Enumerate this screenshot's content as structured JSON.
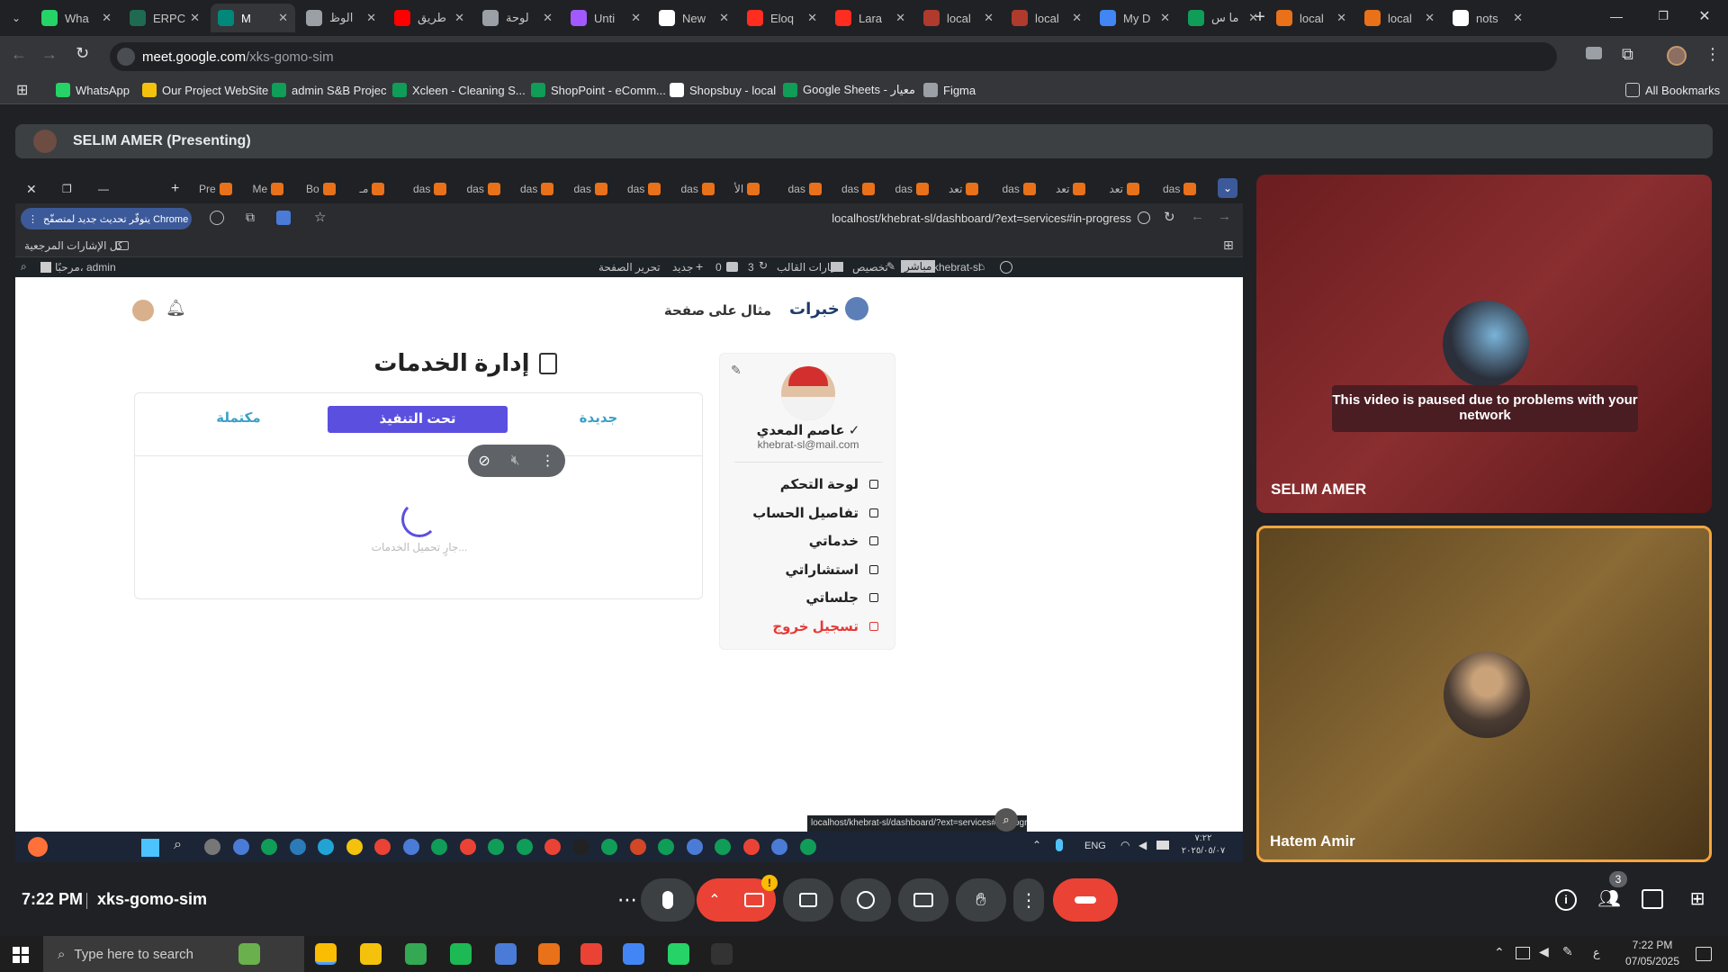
{
  "browser": {
    "tabs": [
      {
        "label": "Wha",
        "color": "#25d366"
      },
      {
        "label": "ERPC",
        "color": "#1e6b52"
      },
      {
        "label": "M",
        "color": "#00897b"
      },
      {
        "label": "الوظ",
        "color": "#9aa0a6"
      },
      {
        "label": "طريق",
        "color": "#ff0000"
      },
      {
        "label": "لوحة",
        "color": "#9aa0a6"
      },
      {
        "label": "Unti",
        "color": "#a259ff"
      },
      {
        "label": "New",
        "color": "#ffffff"
      },
      {
        "label": "Eloq",
        "color": "#ff2d20"
      },
      {
        "label": "Lara",
        "color": "#ff2d20"
      },
      {
        "label": "local",
        "color": "#b03a2e"
      },
      {
        "label": "local",
        "color": "#b03a2e"
      },
      {
        "label": "My D",
        "color": "#4285f4"
      },
      {
        "label": "ما س",
        "color": "#0f9d58"
      },
      {
        "label": "local",
        "color": "#e8711a"
      },
      {
        "label": "local",
        "color": "#e8711a"
      },
      {
        "label": "nots",
        "color": "#ffffff"
      }
    ],
    "url_host": "meet.google.com",
    "url_path": "/xks-gomo-sim",
    "bookmarks": [
      {
        "label": "WhatsApp",
        "color": "#25d366"
      },
      {
        "label": "Our Project WebSite",
        "color": "#f4c20d"
      },
      {
        "label": "admin S&B Projec",
        "color": "#0f9d58"
      },
      {
        "label": "Xcleen - Cleaning S...",
        "color": "#0f9d58"
      },
      {
        "label": "ShopPoint - eComm...",
        "color": "#0f9d58"
      },
      {
        "label": "Shopsbuy - local",
        "color": "#ffffff"
      },
      {
        "label": "Google Sheets - معيار",
        "color": "#0f9d58"
      },
      {
        "label": "Figma",
        "color": "#9aa0a6"
      }
    ],
    "all_bookmarks": "All Bookmarks"
  },
  "meet": {
    "presenter_label": "SELIM AMER (Presenting)",
    "time": "7:22 PM",
    "meeting_code": "xks-gomo-sim",
    "participants_count": "3",
    "notify_badge": "!",
    "paused_message": "This video is paused due to problems with your network",
    "tiles": [
      {
        "name": "SELIM AMER"
      },
      {
        "name": "Hatem Amir"
      }
    ]
  },
  "shared": {
    "inner_tabs": [
      "Pre",
      "Me",
      "Bo",
      "مـ",
      "das",
      "das",
      "das",
      "das",
      "das",
      "das",
      "الأ",
      "das",
      "das",
      "das",
      "تعد",
      "das",
      "تعد",
      "تعد",
      "das"
    ],
    "update_badge": "يتوفّر تحديث جديد لمتصفّح Chrome",
    "inner_url": "localhost/khebrat-sl/dashboard/?ext=services#in-progress",
    "inner_bookmarks": "كل الإشارات المرجعية",
    "wp": {
      "site": "khebrat-sl",
      "live": "مباشر",
      "customize": "تخصيص",
      "options": "خيارات القالب",
      "updates": "3",
      "comments": "0",
      "new": "جديد",
      "edit": "تحرير الصفحة",
      "greeting": "مرحبًا، admin"
    },
    "logo": "خبرات",
    "header_link": "مثال على صفحة",
    "page_title": "إدارة الخدمات",
    "tabs": {
      "new": "جديدة",
      "in_progress": "تحت التنفيذ",
      "completed": "مكتملة"
    },
    "loading_text": "جارٍ تحميل الخدمات...",
    "profile": {
      "name": "عاصم المعدي",
      "email": "khebrat-sl@mail.com"
    },
    "menu": [
      {
        "label": "لوحة التحكم",
        "icon": "home-icon"
      },
      {
        "label": "تفاصيل الحساب",
        "icon": "user-icon"
      },
      {
        "label": "خدماتي",
        "icon": "services-icon"
      },
      {
        "label": "استشاراتي",
        "icon": "consult-icon"
      },
      {
        "label": "جلساتي",
        "icon": "sessions-icon"
      },
      {
        "label": "تسجيل خروج",
        "icon": "logout-icon"
      }
    ],
    "status_url": "localhost/khebrat-sl/dashboard/?ext=services#in-progress",
    "inner_clock": "٧:٢٢",
    "inner_date": "٢٠٢٥/٠٥/٠٧",
    "inner_lang": "ENG"
  },
  "taskbar": {
    "search_placeholder": "Type here to search",
    "time": "7:22 PM",
    "date": "07/05/2025",
    "lang": "ع"
  },
  "colors": {
    "accent": "#5b4fe0",
    "link": "#3ba0c7",
    "logout": "#e53935",
    "meet_red": "#ea4335",
    "tile_highlight": "#f4a640"
  }
}
